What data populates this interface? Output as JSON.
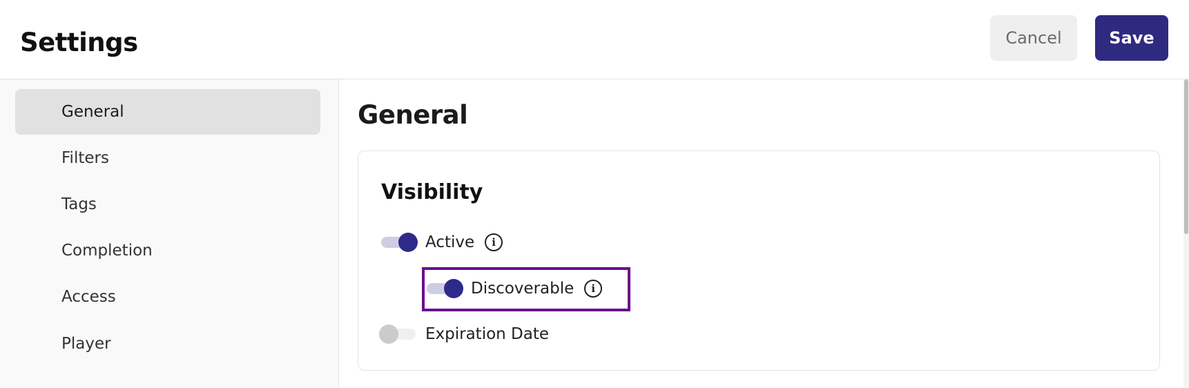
{
  "header": {
    "title": "Settings",
    "cancel_label": "Cancel",
    "save_label": "Save"
  },
  "sidebar": {
    "items": [
      {
        "label": "General",
        "active": true
      },
      {
        "label": "Filters",
        "active": false
      },
      {
        "label": "Tags",
        "active": false
      },
      {
        "label": "Completion",
        "active": false
      },
      {
        "label": "Access",
        "active": false
      },
      {
        "label": "Player",
        "active": false
      }
    ]
  },
  "main": {
    "section_title": "General",
    "visibility": {
      "title": "Visibility",
      "toggles": [
        {
          "label": "Active",
          "on": true,
          "info_icon": "info-icon"
        },
        {
          "label": "Discoverable",
          "on": true,
          "info_icon": "info-icon"
        },
        {
          "label": "Expiration Date",
          "on": false
        }
      ]
    }
  },
  "colors": {
    "accent": "#2e2a80",
    "highlight_outline": "#6a0f8e",
    "toggle_off_thumb": "#cbcbcb"
  }
}
